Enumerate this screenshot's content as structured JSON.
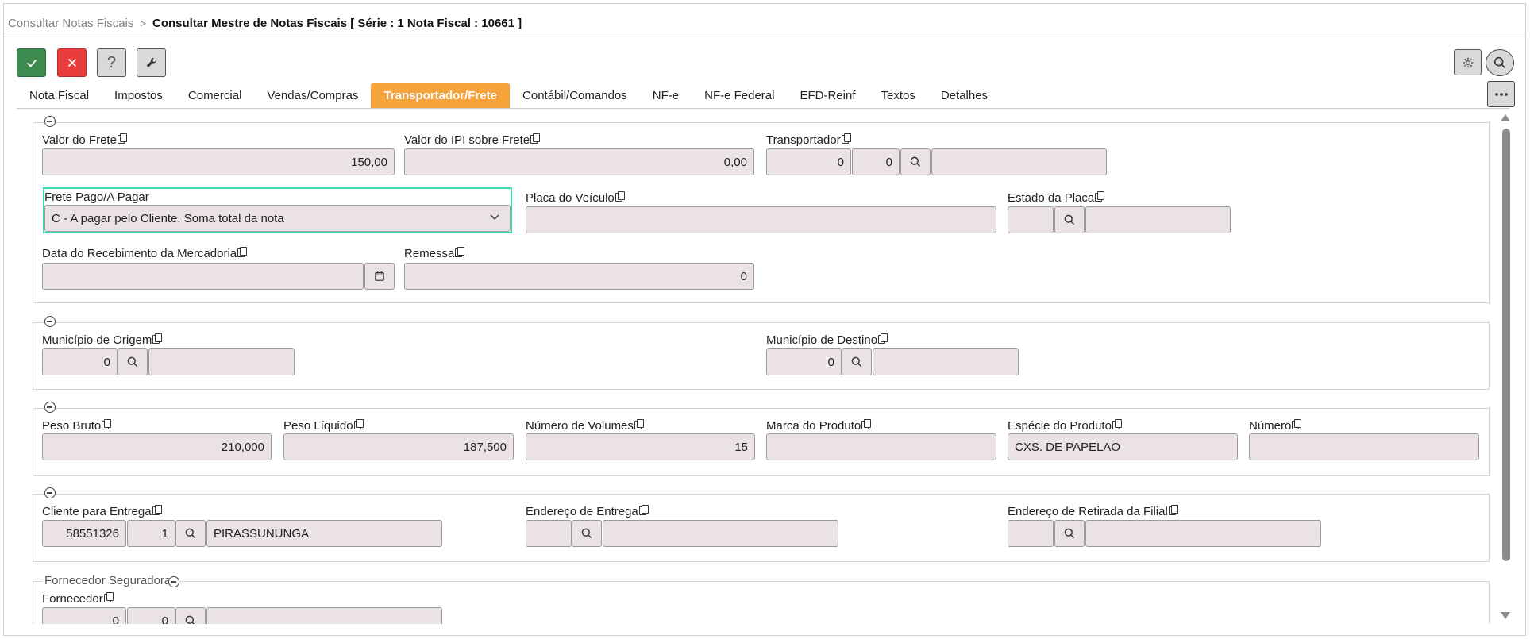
{
  "breadcrumb": {
    "parent": "Consultar Notas Fiscais",
    "separator": ">",
    "current": "Consultar Mestre de Notas Fiscais [ Série : 1 Nota Fiscal : 10661 ]"
  },
  "toolbar": {
    "help_label": "?"
  },
  "tabs": [
    {
      "label": "Nota Fiscal"
    },
    {
      "label": "Impostos"
    },
    {
      "label": "Comercial"
    },
    {
      "label": "Vendas/Compras"
    },
    {
      "label": "Transportador/Frete",
      "active": true
    },
    {
      "label": "Contábil/Comandos"
    },
    {
      "label": "NF-e"
    },
    {
      "label": "NF-e Federal"
    },
    {
      "label": "EFD-Reinf"
    },
    {
      "label": "Textos"
    },
    {
      "label": "Detalhes"
    }
  ],
  "frete": {
    "valor_frete": {
      "label": "Valor do Frete",
      "value": "150,00"
    },
    "valor_ipi_frete": {
      "label": "Valor do IPI sobre Frete",
      "value": "0,00"
    },
    "transportador": {
      "label": "Transportador",
      "code1": "0",
      "code2": "0",
      "name": ""
    },
    "frete_pago": {
      "label": "Frete Pago/A Pagar",
      "value": "C - A pagar pelo Cliente. Soma total da nota"
    },
    "placa_veiculo": {
      "label": "Placa do Veículo",
      "value": ""
    },
    "estado_placa": {
      "label": "Estado da Placa",
      "code": "",
      "name": ""
    },
    "data_recebimento": {
      "label": "Data do Recebimento da Mercadoria",
      "value": ""
    },
    "remessa": {
      "label": "Remessa",
      "value": "0"
    }
  },
  "municipios": {
    "origem": {
      "label": "Município de Origem",
      "code": "0",
      "name": ""
    },
    "destino": {
      "label": "Município de Destino",
      "code": "0",
      "name": ""
    }
  },
  "volumes": {
    "peso_bruto": {
      "label": "Peso Bruto",
      "value": "210,000"
    },
    "peso_liquido": {
      "label": "Peso Líquido",
      "value": "187,500"
    },
    "numero_volumes": {
      "label": "Número de Volumes",
      "value": "15"
    },
    "marca_produto": {
      "label": "Marca do Produto",
      "value": ""
    },
    "especie_produto": {
      "label": "Espécie do Produto",
      "value": "CXS. DE PAPELAO"
    },
    "numero": {
      "label": "Número",
      "value": ""
    }
  },
  "entrega": {
    "cliente": {
      "label": "Cliente para Entrega",
      "code": "58551326",
      "seq": "1",
      "name": "PIRASSUNUNGA"
    },
    "endereco_entrega": {
      "label": "Endereço de Entrega",
      "code": "",
      "name": ""
    },
    "endereco_retirada": {
      "label": "Endereço de Retirada da Filial",
      "code": "",
      "name": ""
    }
  },
  "seguradora": {
    "legend": "Fornecedor Seguradora",
    "fornecedor": {
      "label": "Fornecedor",
      "code1": "0",
      "code2": "0",
      "name": ""
    }
  }
}
